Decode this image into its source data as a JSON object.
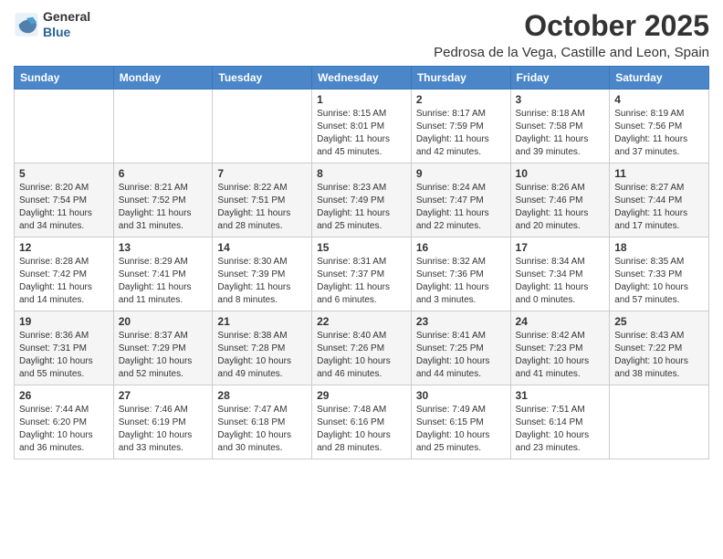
{
  "logo": {
    "general": "General",
    "blue": "Blue"
  },
  "title": "October 2025",
  "subtitle": "Pedrosa de la Vega, Castille and Leon, Spain",
  "days_of_week": [
    "Sunday",
    "Monday",
    "Tuesday",
    "Wednesday",
    "Thursday",
    "Friday",
    "Saturday"
  ],
  "weeks": [
    [
      {
        "day": "",
        "info": ""
      },
      {
        "day": "",
        "info": ""
      },
      {
        "day": "",
        "info": ""
      },
      {
        "day": "1",
        "info": "Sunrise: 8:15 AM\nSunset: 8:01 PM\nDaylight: 11 hours and 45 minutes."
      },
      {
        "day": "2",
        "info": "Sunrise: 8:17 AM\nSunset: 7:59 PM\nDaylight: 11 hours and 42 minutes."
      },
      {
        "day": "3",
        "info": "Sunrise: 8:18 AM\nSunset: 7:58 PM\nDaylight: 11 hours and 39 minutes."
      },
      {
        "day": "4",
        "info": "Sunrise: 8:19 AM\nSunset: 7:56 PM\nDaylight: 11 hours and 37 minutes."
      }
    ],
    [
      {
        "day": "5",
        "info": "Sunrise: 8:20 AM\nSunset: 7:54 PM\nDaylight: 11 hours and 34 minutes."
      },
      {
        "day": "6",
        "info": "Sunrise: 8:21 AM\nSunset: 7:52 PM\nDaylight: 11 hours and 31 minutes."
      },
      {
        "day": "7",
        "info": "Sunrise: 8:22 AM\nSunset: 7:51 PM\nDaylight: 11 hours and 28 minutes."
      },
      {
        "day": "8",
        "info": "Sunrise: 8:23 AM\nSunset: 7:49 PM\nDaylight: 11 hours and 25 minutes."
      },
      {
        "day": "9",
        "info": "Sunrise: 8:24 AM\nSunset: 7:47 PM\nDaylight: 11 hours and 22 minutes."
      },
      {
        "day": "10",
        "info": "Sunrise: 8:26 AM\nSunset: 7:46 PM\nDaylight: 11 hours and 20 minutes."
      },
      {
        "day": "11",
        "info": "Sunrise: 8:27 AM\nSunset: 7:44 PM\nDaylight: 11 hours and 17 minutes."
      }
    ],
    [
      {
        "day": "12",
        "info": "Sunrise: 8:28 AM\nSunset: 7:42 PM\nDaylight: 11 hours and 14 minutes."
      },
      {
        "day": "13",
        "info": "Sunrise: 8:29 AM\nSunset: 7:41 PM\nDaylight: 11 hours and 11 minutes."
      },
      {
        "day": "14",
        "info": "Sunrise: 8:30 AM\nSunset: 7:39 PM\nDaylight: 11 hours and 8 minutes."
      },
      {
        "day": "15",
        "info": "Sunrise: 8:31 AM\nSunset: 7:37 PM\nDaylight: 11 hours and 6 minutes."
      },
      {
        "day": "16",
        "info": "Sunrise: 8:32 AM\nSunset: 7:36 PM\nDaylight: 11 hours and 3 minutes."
      },
      {
        "day": "17",
        "info": "Sunrise: 8:34 AM\nSunset: 7:34 PM\nDaylight: 11 hours and 0 minutes."
      },
      {
        "day": "18",
        "info": "Sunrise: 8:35 AM\nSunset: 7:33 PM\nDaylight: 10 hours and 57 minutes."
      }
    ],
    [
      {
        "day": "19",
        "info": "Sunrise: 8:36 AM\nSunset: 7:31 PM\nDaylight: 10 hours and 55 minutes."
      },
      {
        "day": "20",
        "info": "Sunrise: 8:37 AM\nSunset: 7:29 PM\nDaylight: 10 hours and 52 minutes."
      },
      {
        "day": "21",
        "info": "Sunrise: 8:38 AM\nSunset: 7:28 PM\nDaylight: 10 hours and 49 minutes."
      },
      {
        "day": "22",
        "info": "Sunrise: 8:40 AM\nSunset: 7:26 PM\nDaylight: 10 hours and 46 minutes."
      },
      {
        "day": "23",
        "info": "Sunrise: 8:41 AM\nSunset: 7:25 PM\nDaylight: 10 hours and 44 minutes."
      },
      {
        "day": "24",
        "info": "Sunrise: 8:42 AM\nSunset: 7:23 PM\nDaylight: 10 hours and 41 minutes."
      },
      {
        "day": "25",
        "info": "Sunrise: 8:43 AM\nSunset: 7:22 PM\nDaylight: 10 hours and 38 minutes."
      }
    ],
    [
      {
        "day": "26",
        "info": "Sunrise: 7:44 AM\nSunset: 6:20 PM\nDaylight: 10 hours and 36 minutes."
      },
      {
        "day": "27",
        "info": "Sunrise: 7:46 AM\nSunset: 6:19 PM\nDaylight: 10 hours and 33 minutes."
      },
      {
        "day": "28",
        "info": "Sunrise: 7:47 AM\nSunset: 6:18 PM\nDaylight: 10 hours and 30 minutes."
      },
      {
        "day": "29",
        "info": "Sunrise: 7:48 AM\nSunset: 6:16 PM\nDaylight: 10 hours and 28 minutes."
      },
      {
        "day": "30",
        "info": "Sunrise: 7:49 AM\nSunset: 6:15 PM\nDaylight: 10 hours and 25 minutes."
      },
      {
        "day": "31",
        "info": "Sunrise: 7:51 AM\nSunset: 6:14 PM\nDaylight: 10 hours and 23 minutes."
      },
      {
        "day": "",
        "info": ""
      }
    ]
  ]
}
